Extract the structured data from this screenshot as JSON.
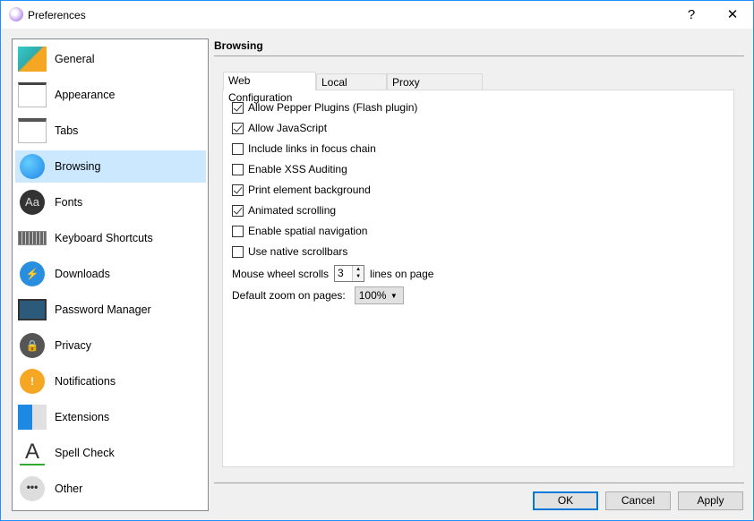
{
  "window": {
    "title": "Preferences",
    "help": "?",
    "close": "✕"
  },
  "sidebar": {
    "items": [
      {
        "label": "General",
        "icon": "general-settings-icon"
      },
      {
        "label": "Appearance",
        "icon": "appearance-window-icon"
      },
      {
        "label": "Tabs",
        "icon": "tabs-window-icon"
      },
      {
        "label": "Browsing",
        "icon": "globe-icon",
        "selected": true
      },
      {
        "label": "Fonts",
        "icon": "fonts-icon"
      },
      {
        "label": "Keyboard Shortcuts",
        "icon": "keyboard-icon"
      },
      {
        "label": "Downloads",
        "icon": "downloads-icon"
      },
      {
        "label": "Password Manager",
        "icon": "password-manager-icon"
      },
      {
        "label": "Privacy",
        "icon": "privacy-lock-icon"
      },
      {
        "label": "Notifications",
        "icon": "notification-icon"
      },
      {
        "label": "Extensions",
        "icon": "extensions-icon"
      },
      {
        "label": "Spell Check",
        "icon": "spell-check-icon"
      },
      {
        "label": "Other",
        "icon": "other-dots-icon"
      }
    ]
  },
  "main": {
    "header": "Browsing",
    "tabs": [
      {
        "label": "Web Configuration",
        "selected": true
      },
      {
        "label": "Local Storage"
      },
      {
        "label": "Proxy Configuration"
      }
    ],
    "options": [
      {
        "label": "Allow Pepper Plugins (Flash plugin)",
        "checked": true
      },
      {
        "label": "Allow JavaScript",
        "checked": true
      },
      {
        "label": "Include links in focus chain",
        "checked": false
      },
      {
        "label": "Enable XSS Auditing",
        "checked": false
      },
      {
        "label": "Print element background",
        "checked": true
      },
      {
        "label": "Animated scrolling",
        "checked": true
      },
      {
        "label": "Enable spatial navigation",
        "checked": false
      },
      {
        "label": "Use native scrollbars",
        "checked": false
      }
    ],
    "wheel": {
      "label": "Mouse wheel scrolls",
      "value": "3",
      "suffix": "lines on page"
    },
    "zoom": {
      "label": "Default zoom on pages:",
      "value": "100%"
    }
  },
  "buttons": {
    "ok": "OK",
    "cancel": "Cancel",
    "apply": "Apply"
  },
  "colors": {
    "selection": "#cce8ff",
    "accent": "#0078d7"
  }
}
